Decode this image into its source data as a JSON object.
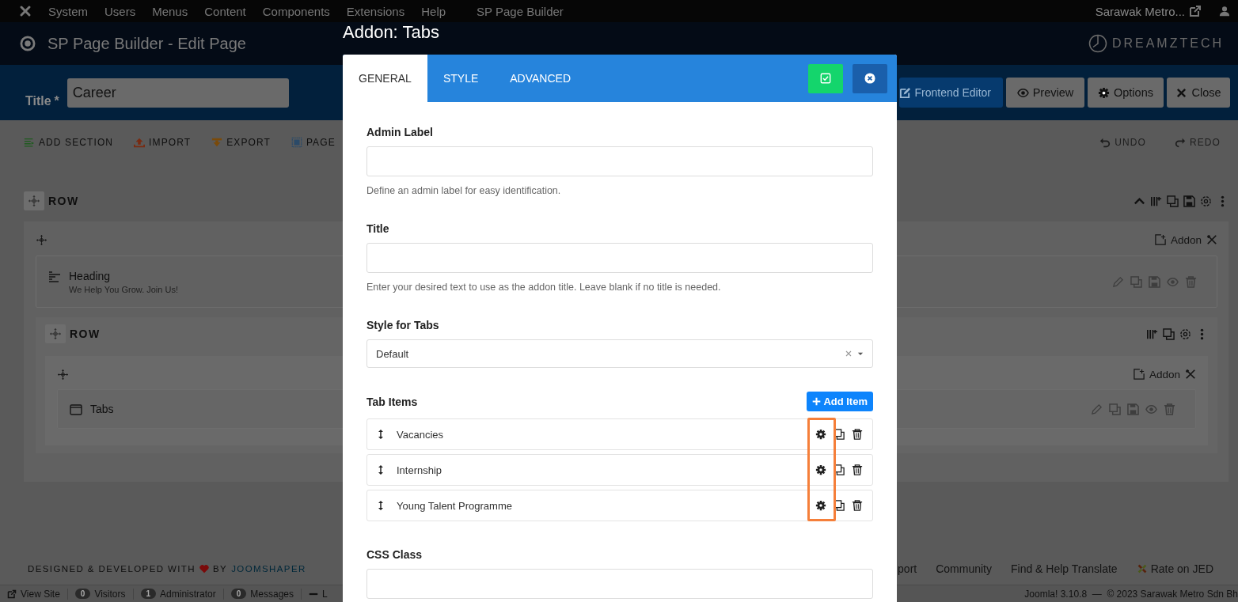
{
  "top_menu": {
    "items": [
      "System",
      "Users",
      "Menus",
      "Content",
      "Components",
      "Extensions",
      "Help",
      "SP Page Builder"
    ],
    "site_name": "Sarawak Metro..."
  },
  "header": {
    "title": "SP Page Builder - Edit Page",
    "logo_text": "DREAMZTECH"
  },
  "title_field": {
    "label": "Title",
    "required_mark": "*",
    "value": "Career"
  },
  "toolbar_buttons": [
    {
      "label": "Frontend Editor",
      "kind": "primary"
    },
    {
      "label": "Preview",
      "kind": "default"
    },
    {
      "label": "Options",
      "kind": "default"
    },
    {
      "label": "Close",
      "kind": "default"
    }
  ],
  "builder_actions": {
    "left": [
      "ADD SECTION",
      "IMPORT",
      "EXPORT",
      "PAGE"
    ],
    "right": [
      "UNDO",
      "REDO"
    ]
  },
  "builder": {
    "label": "ROW",
    "addon_button": "Addon",
    "addons": [
      {
        "kind": "heading",
        "title": "Heading",
        "subtitle": "We Help You Grow. Join Us!"
      }
    ],
    "inner_row": {
      "label": "ROW",
      "addon_button": "Addon",
      "addons": [
        {
          "kind": "tabs",
          "title": "Tabs"
        }
      ]
    }
  },
  "footer": {
    "credit_prefix": "DESIGNED & DEVELOPED WITH",
    "credit_by": "BY",
    "credit_link": "JOOMSHAPER",
    "links": [
      "port",
      "Community",
      "Find & Help Translate",
      "Rate on JED"
    ]
  },
  "status_bar": {
    "items": [
      {
        "kind": "link",
        "label": "View Site"
      },
      {
        "kind": "count",
        "count": "0",
        "label": "Visitors"
      },
      {
        "kind": "count",
        "count": "1",
        "label": "Administrator"
      },
      {
        "kind": "count",
        "count": "0",
        "label": "Messages"
      },
      {
        "kind": "logout",
        "label": "L"
      }
    ],
    "copyright": "Joomla! 3.10.8  —  © 2023 Sarawak Metro Sdn Bh"
  },
  "modal": {
    "title": "Addon: Tabs",
    "tabs": [
      {
        "label": "GENERAL",
        "selected": true
      },
      {
        "label": "STYLE",
        "selected": false
      },
      {
        "label": "ADVANCED",
        "selected": false
      }
    ],
    "fields": [
      {
        "kind": "text",
        "label": "Admin Label",
        "help": "Define an admin label for easy identification."
      },
      {
        "kind": "text",
        "label": "Title",
        "help": "Enter your desired text to use as the addon title. Leave blank if no title is needed."
      },
      {
        "kind": "select",
        "label": "Style for Tabs",
        "value": "Default"
      },
      {
        "kind": "items",
        "label": "Tab Items",
        "add_button": "Add Item",
        "items": [
          "Vacancies",
          "Internship",
          "Young Talent Programme"
        ]
      },
      {
        "kind": "text",
        "label": "CSS Class"
      }
    ]
  }
}
